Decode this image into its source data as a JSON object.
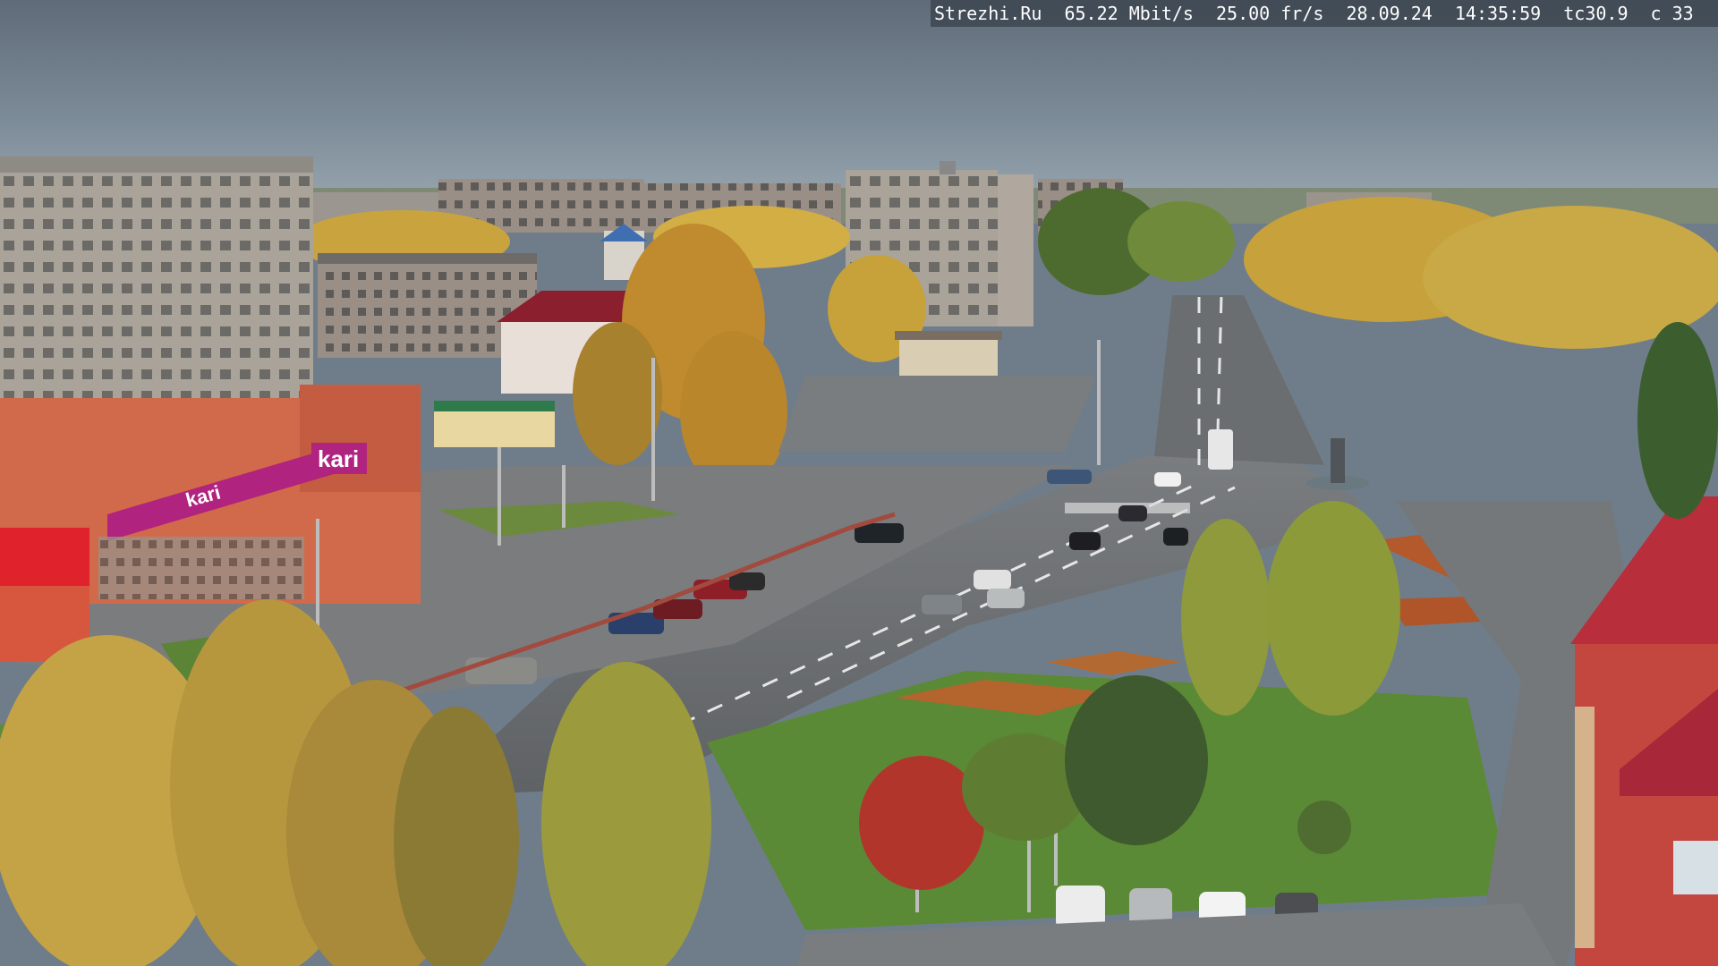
{
  "overlay": {
    "site": "Strezhi.Ru",
    "bitrate": "65.22 Mbit/s",
    "framerate": "25.00 fr/s",
    "date": "28.09.24",
    "time": "14:35:59",
    "tc": "tc30.9",
    "c": "c 33"
  },
  "signs": {
    "store_brand": "kari",
    "store_banner_brand": "kari"
  },
  "colors": {
    "sky_top": "#6b7683",
    "sky_bottom": "#8a9ba6",
    "asphalt": "#6e7173",
    "grass": "#5f8a3a",
    "autumn_foliage": "#c8a13a",
    "kari_magenta": "#b0237e",
    "brick": "#c55a3e"
  }
}
